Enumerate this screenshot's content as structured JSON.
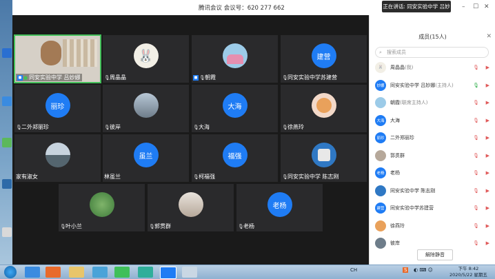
{
  "window": {
    "title": "腾讯会议 会议号：620 277 662",
    "speaking": "正在讲话: 同安实验中学 吕妙娜:"
  },
  "tiles": [
    {
      "name": "同安实验中学 吕妙娜",
      "avatar": ""
    },
    {
      "name": "周晶晶",
      "avatar": ""
    },
    {
      "name": "朝霞",
      "avatar": ""
    },
    {
      "name": "同安实验中学苏建营",
      "avatar": "建营"
    },
    {
      "name": "二外郑丽珍",
      "avatar": "丽珍"
    },
    {
      "name": "彼岸",
      "avatar": ""
    },
    {
      "name": "大海",
      "avatar": "大海"
    },
    {
      "name": "徐燕玲",
      "avatar": ""
    },
    {
      "name": "家有淑女",
      "avatar": ""
    },
    {
      "name": "林虽兰",
      "avatar": "虽兰"
    },
    {
      "name": "柯福强",
      "avatar": "福强"
    },
    {
      "name": "同安实验中学 陈志刚",
      "avatar": ""
    },
    {
      "name": "叶小兰",
      "avatar": ""
    },
    {
      "name": "郭贯群",
      "avatar": ""
    },
    {
      "name": "老杨",
      "avatar": "老杨"
    }
  ],
  "panel": {
    "title": "成员(15人)",
    "search_placeholder": "搜索成员",
    "unmute_label": "解除静音",
    "members": [
      {
        "name": "周晶晶",
        "role": "(我)",
        "avatar": ""
      },
      {
        "name": "同安实验中学 吕妙娜",
        "role": "(主持人)",
        "avatar": "妙娜"
      },
      {
        "name": "朝霞",
        "role": "(联席主持人)",
        "avatar": ""
      },
      {
        "name": "大海",
        "role": "",
        "avatar": "大海"
      },
      {
        "name": "二外郑丽珍",
        "role": "",
        "avatar": "丽珍"
      },
      {
        "name": "郭贯群",
        "role": "",
        "avatar": ""
      },
      {
        "name": "老杨",
        "role": "",
        "avatar": "老杨"
      },
      {
        "name": "同安实验中学 陈志刚",
        "role": "",
        "avatar": ""
      },
      {
        "name": "同安实验中学苏建营",
        "role": "",
        "avatar": "建营"
      },
      {
        "name": "徐燕玲",
        "role": "",
        "avatar": ""
      },
      {
        "name": "彼岸",
        "role": "",
        "avatar": ""
      }
    ]
  },
  "taskbar": {
    "tray_lang": "CH",
    "time": "下午 8:42",
    "date": "2020/5/22 星期五"
  },
  "colors": {
    "accent": "#1f7cf4",
    "stage": "#1a1a1a",
    "muted": "#e05a5a",
    "active": "#43c05a"
  }
}
